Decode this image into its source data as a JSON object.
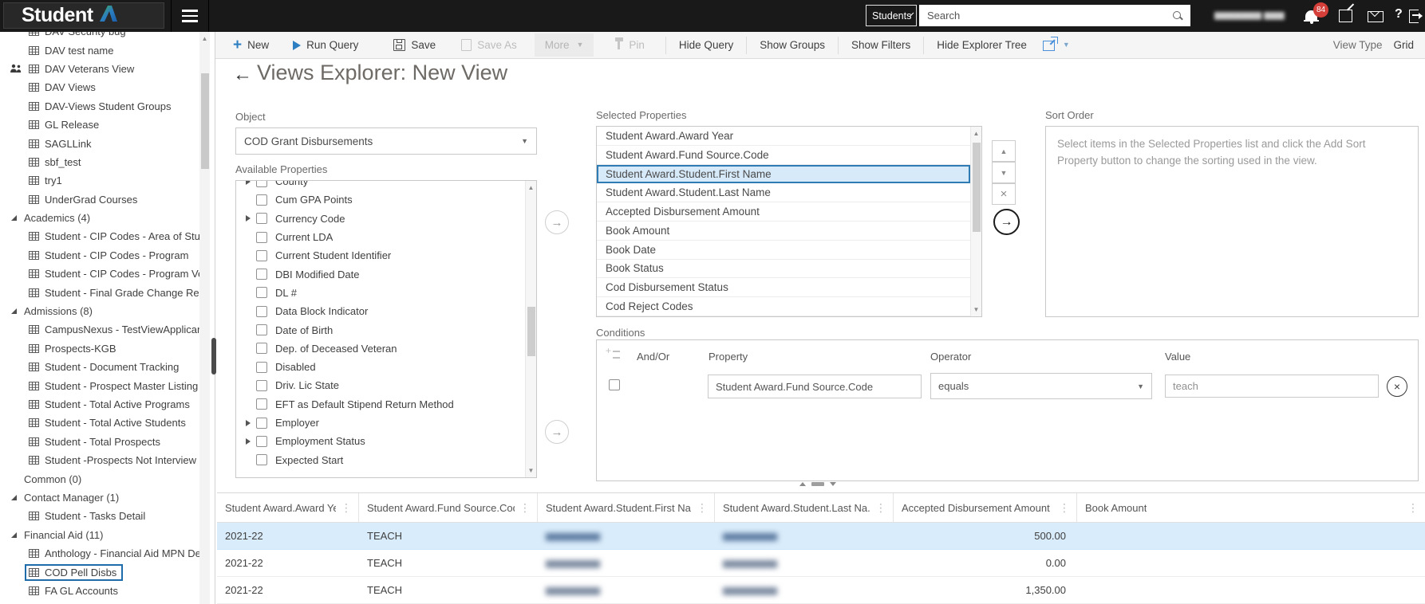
{
  "topbar": {
    "logo": "Student",
    "scope": "Students",
    "search_placeholder": "Search",
    "user_name_redacted": "▆▆▆▆▆▆▆ ▆▆▆",
    "notification_count": "84",
    "help": "?"
  },
  "toolbar": {
    "new": "New",
    "run_query": "Run Query",
    "save": "Save",
    "save_as": "Save As",
    "more": "More",
    "pin": "Pin",
    "hide_query": "Hide Query",
    "show_groups": "Show Groups",
    "show_filters": "Show Filters",
    "hide_explorer_tree": "Hide Explorer Tree",
    "view_type_label": "View Type",
    "view_type_value": "Grid"
  },
  "page": {
    "title": "Views Explorer: New View"
  },
  "sidebar": {
    "items": [
      {
        "label": "DAV Security bug"
      },
      {
        "label": "DAV test name"
      },
      {
        "label": "DAV Veterans View"
      },
      {
        "label": "DAV Views"
      },
      {
        "label": "DAV-Views Student Groups"
      },
      {
        "label": "GL Release"
      },
      {
        "label": "SAGLLink"
      },
      {
        "label": "sbf_test"
      },
      {
        "label": "try1"
      },
      {
        "label": "UnderGrad Courses"
      },
      {
        "label": "Academics (4)"
      },
      {
        "label": "Student - CIP Codes - Area of Stud"
      },
      {
        "label": "Student - CIP Codes - Program"
      },
      {
        "label": "Student - CIP Codes - Program Ve"
      },
      {
        "label": "Student - Final Grade Change Rea"
      },
      {
        "label": "Admissions (8)"
      },
      {
        "label": "CampusNexus - TestViewApplicar"
      },
      {
        "label": "Prospects-KGB"
      },
      {
        "label": "Student - Document Tracking"
      },
      {
        "label": "Student - Prospect Master Listing"
      },
      {
        "label": "Student - Total Active Programs"
      },
      {
        "label": "Student - Total Active Students"
      },
      {
        "label": "Student - Total Prospects"
      },
      {
        "label": "Student -Prospects Not Interview"
      },
      {
        "label": "Common (0)"
      },
      {
        "label": "Contact Manager (1)"
      },
      {
        "label": "Student - Tasks Detail"
      },
      {
        "label": "Financial Aid (11)"
      },
      {
        "label": "Anthology - Financial Aid MPN De"
      },
      {
        "label": "COD Pell Disbs"
      },
      {
        "label": "FA GL Accounts"
      }
    ]
  },
  "query": {
    "object": {
      "label": "Object",
      "value": "COD Grant Disbursements"
    },
    "available": {
      "label": "Available Properties",
      "items": [
        "County",
        "Cum GPA Points",
        "Currency Code",
        "Current LDA",
        "Current Student Identifier",
        "DBI Modified Date",
        "DL #",
        "Data Block Indicator",
        "Date of Birth",
        "Dep. of Deceased Veteran",
        "Disabled",
        "Driv. Lic State",
        "EFT as Default Stipend Return Method",
        "Employer",
        "Employment Status",
        "Expected Start"
      ]
    },
    "selected": {
      "label": "Selected Properties",
      "items": [
        "Student Award.Award Year",
        "Student Award.Fund Source.Code",
        "Student Award.Student.First Name",
        "Student Award.Student.Last Name",
        "Accepted Disbursement Amount",
        "Book Amount",
        "Book Date",
        "Book Status",
        "Cod Disbursement Status",
        "Cod Reject Codes"
      ],
      "selected_index": 2
    },
    "sort": {
      "label": "Sort Order",
      "placeholder": "Select items in the Selected Properties list and click the Add Sort Property button to change the sorting used in the view."
    },
    "conditions": {
      "label": "Conditions",
      "and_or_label": "And/Or",
      "property_label": "Property",
      "operator_label": "Operator",
      "value_label": "Value",
      "rows": [
        {
          "property": "Student Award.Fund Source.Code",
          "operator": "equals",
          "value": "teach"
        }
      ]
    }
  },
  "grid": {
    "names_blurred": true,
    "columns": [
      "Student Award.Award Year",
      "Student Award.Fund Source.Code",
      "Student Award.Student.First Na...",
      "Student Award.Student.Last Na...",
      "Accepted Disbursement Amount",
      "Book Amount"
    ],
    "rows": [
      {
        "award_year": "2021-22",
        "fund_source": "TEACH",
        "first_name": "▆▆▆▆▆▆▆▆▆",
        "last_name": "▆▆▆▆▆▆▆▆▆",
        "accepted_amount": "500.00",
        "book_amount": ""
      },
      {
        "award_year": "2021-22",
        "fund_source": "TEACH",
        "first_name": "▆▆▆▆▆▆▆▆▆",
        "last_name": "▆▆▆▆▆▆▆▆▆",
        "accepted_amount": "0.00",
        "book_amount": ""
      },
      {
        "award_year": "2021-22",
        "fund_source": "TEACH",
        "first_name": "▆▆▆▆▆▆▆▆▆",
        "last_name": "▆▆▆▆▆▆▆▆▆",
        "accepted_amount": "1,350.00",
        "book_amount": ""
      }
    ]
  },
  "glyphs": {
    "plus": "+",
    "back_arrow": "←",
    "caret_down": "▼",
    "arrow_right": "→",
    "close": "×",
    "menu_dots": "⋮",
    "triangle_up": "▲",
    "triangle_down": "▼"
  },
  "colors": {
    "accent_blue": "#2e7fc2",
    "selection_fill": "#d7eafa",
    "selection_border": "#2f7cb5",
    "grid_selected_row": "#d9ecfb",
    "badge_red": "#d43f3a",
    "topbar_bg": "#191919"
  }
}
